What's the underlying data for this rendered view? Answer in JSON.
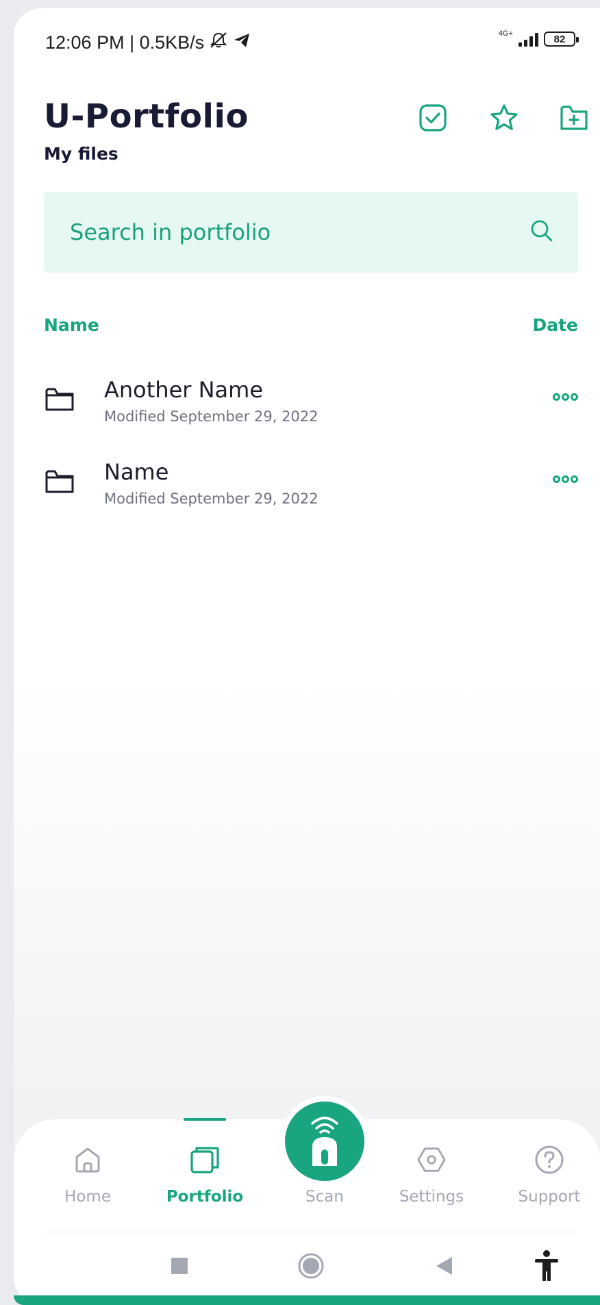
{
  "status_bar": {
    "time_speed": "12:06 PM | 0.5KB/s",
    "network_type": "4G+",
    "battery_level": "82"
  },
  "header": {
    "title": "U-Portfolio",
    "subtitle": "My files",
    "actions": [
      "checkbox-select-icon",
      "star-icon",
      "add-folder-icon"
    ]
  },
  "search": {
    "placeholder": "Search in portfolio"
  },
  "list_headers": {
    "name": "Name",
    "date": "Date"
  },
  "files": [
    {
      "name": "Another Name",
      "modified": "Modified September 29, 2022",
      "icon": "folder-icon"
    },
    {
      "name": "Name",
      "modified": "Modified September 29, 2022",
      "icon": "folder-icon"
    }
  ],
  "bottom_nav": {
    "items": [
      {
        "label": "Home",
        "icon": "home-icon",
        "active": false
      },
      {
        "label": "Portfolio",
        "icon": "portfolio-icon",
        "active": true
      },
      {
        "label": "Scan",
        "icon": "scan-icon",
        "active": false
      },
      {
        "label": "Settings",
        "icon": "settings-icon",
        "active": false
      },
      {
        "label": "Support",
        "icon": "help-icon",
        "active": false
      }
    ]
  },
  "colors": {
    "accent": "#18a57f",
    "search_bg": "#e5f9f2",
    "title": "#191a34",
    "inactive": "#a4a8b3"
  }
}
